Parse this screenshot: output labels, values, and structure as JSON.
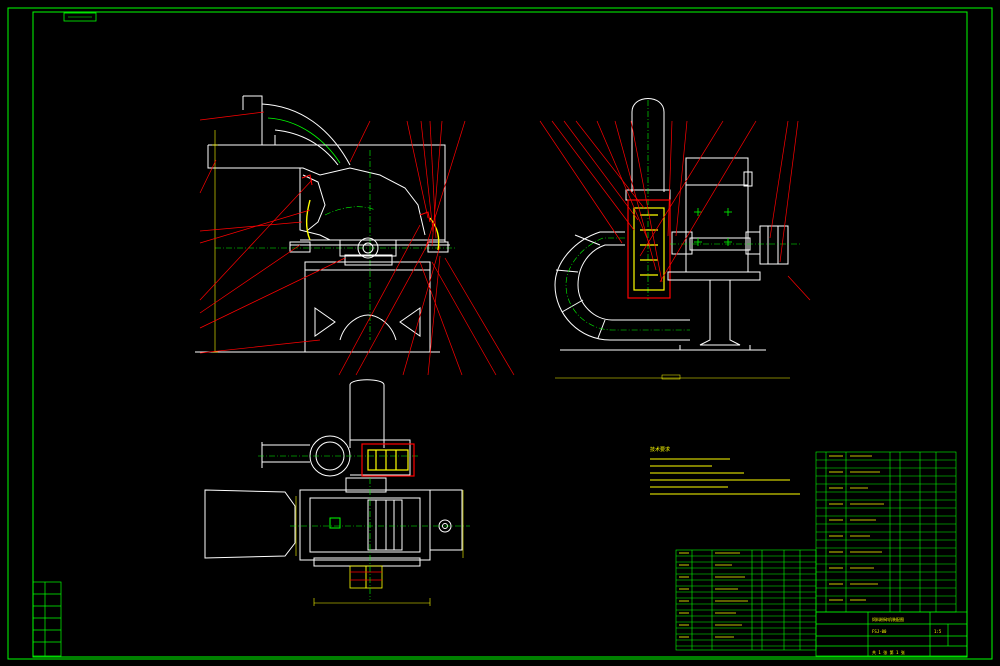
{
  "colors": {
    "background": "#000000",
    "frame": "#00ff00",
    "outline": "#ffffff",
    "leader": "#ff0000",
    "centerline": "#00ff00",
    "dimension": "#ffff00",
    "part_highlight": "#ff0000"
  },
  "drawing_views": [
    "front-view",
    "side-view",
    "top-view"
  ],
  "tech_notes_title": "技术要求",
  "title_block": {
    "drawing_title": "饲料粉碎机装配图",
    "drawing_number": "FSJ-00",
    "sheet_label": "共 1 张 第 1 张",
    "scale": "1:5"
  }
}
